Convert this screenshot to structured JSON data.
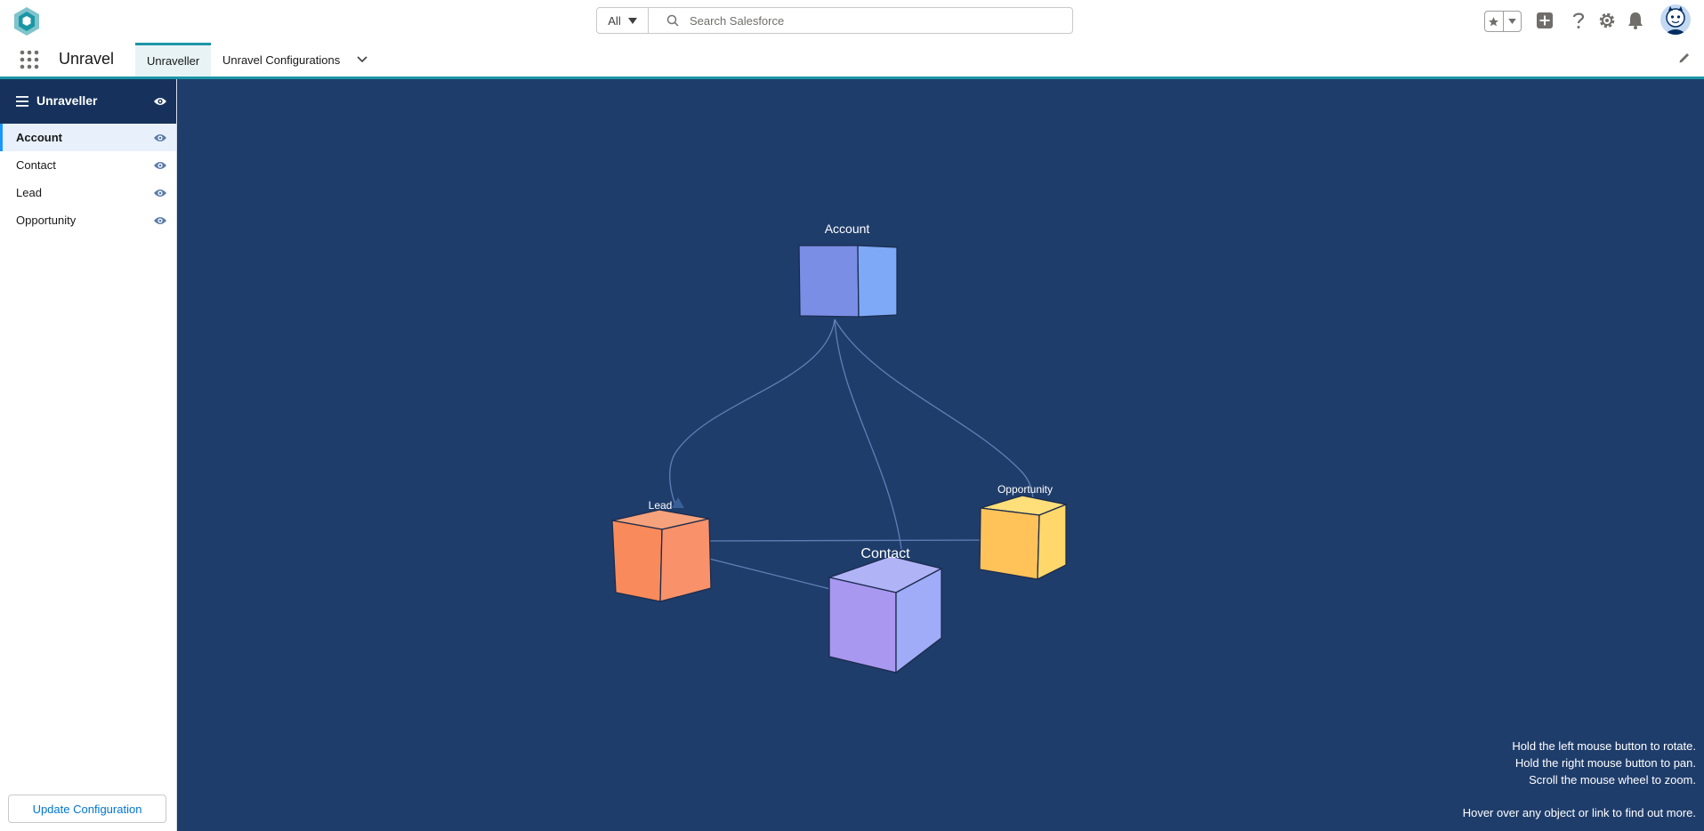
{
  "header": {
    "search_scope": "All",
    "search_placeholder": "Search Salesforce"
  },
  "nav": {
    "app_name": "Unravel",
    "tabs": [
      {
        "label": "Unraveller",
        "active": true
      },
      {
        "label": "Unravel Configurations",
        "active": false
      }
    ]
  },
  "sidebar": {
    "title": "Unraveller",
    "items": [
      {
        "label": "Account",
        "active": true
      },
      {
        "label": "Contact",
        "active": false
      },
      {
        "label": "Lead",
        "active": false
      },
      {
        "label": "Opportunity",
        "active": false
      }
    ],
    "update_button": "Update Configuration"
  },
  "graph": {
    "nodes": [
      {
        "label": "Account",
        "color": "#7b8ee6"
      },
      {
        "label": "Lead",
        "color": "#f98a5b"
      },
      {
        "label": "Contact",
        "color": "#a998f0"
      },
      {
        "label": "Opportunity",
        "color": "#ffc35a"
      }
    ],
    "links": [
      {
        "from": "Account",
        "to": "Lead"
      },
      {
        "from": "Account",
        "to": "Contact"
      },
      {
        "from": "Account",
        "to": "Opportunity"
      },
      {
        "from": "Lead",
        "to": "Opportunity"
      },
      {
        "from": "Contact",
        "to": "Lead"
      }
    ]
  },
  "help_text": {
    "line1": "Hold the left mouse button to rotate.",
    "line2": "Hold the right mouse button to pan.",
    "line3": "Scroll the mouse wheel to zoom.",
    "line4": "Hover over any object or link to find out more."
  },
  "colors": {
    "brand": "#1b96a6",
    "sidebar_header": "#16325c",
    "canvas_bg": "#1f3d6b",
    "link_button": "#0176d3"
  }
}
